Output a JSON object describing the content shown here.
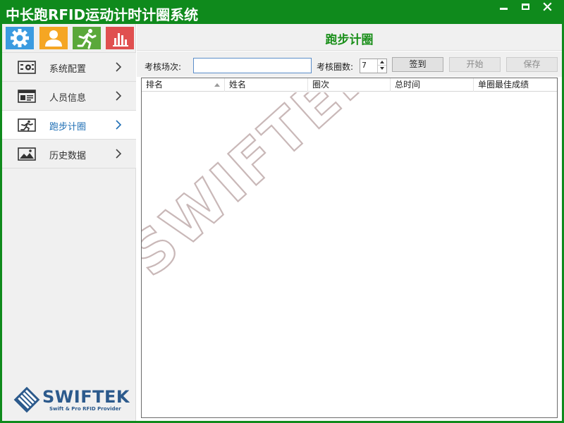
{
  "app": {
    "title": "中长跑RFID运动计时计圈系统"
  },
  "window_controls": {
    "minimize": "minimize",
    "maximize": "maximize",
    "close": "close"
  },
  "quick_icons": [
    {
      "icon": "gear-icon",
      "color": "#3b9be0"
    },
    {
      "icon": "user-icon",
      "color": "#f5a623"
    },
    {
      "icon": "runner-icon",
      "color": "#5aa83a"
    },
    {
      "icon": "bar-chart-icon",
      "color": "#e05050"
    }
  ],
  "sidebar": {
    "items": [
      {
        "label": "系统配置",
        "icon": "settings-panel-icon",
        "active": false
      },
      {
        "label": "人员信息",
        "icon": "id-card-icon",
        "active": false
      },
      {
        "label": "跑步计圈",
        "icon": "runner-icon",
        "active": true
      },
      {
        "label": "历史数据",
        "icon": "image-icon",
        "active": false
      }
    ]
  },
  "brand": {
    "name": "SWIFTEK",
    "tagline": "Swift & Pro RFID Provider"
  },
  "main": {
    "page_title": "跑步计圈",
    "toolbar": {
      "session_label": "考核场次:",
      "session_value": "",
      "laps_label": "考核圈数:",
      "laps_value": "7",
      "signin_label": "签到",
      "start_label": "开始",
      "save_label": "保存"
    },
    "table": {
      "columns": [
        "排名",
        "姓名",
        "圈次",
        "总时间",
        "单圈最佳成绩"
      ],
      "sort_column": "排名",
      "sort_direction": "ascending",
      "rows": []
    },
    "watermark": "SWIFTEK"
  },
  "colors": {
    "title_bar": "#0f8a1c",
    "page_title": "#1a8f1a",
    "active_menu_text": "#1f6fb5",
    "brand": "#2c5a8c"
  }
}
